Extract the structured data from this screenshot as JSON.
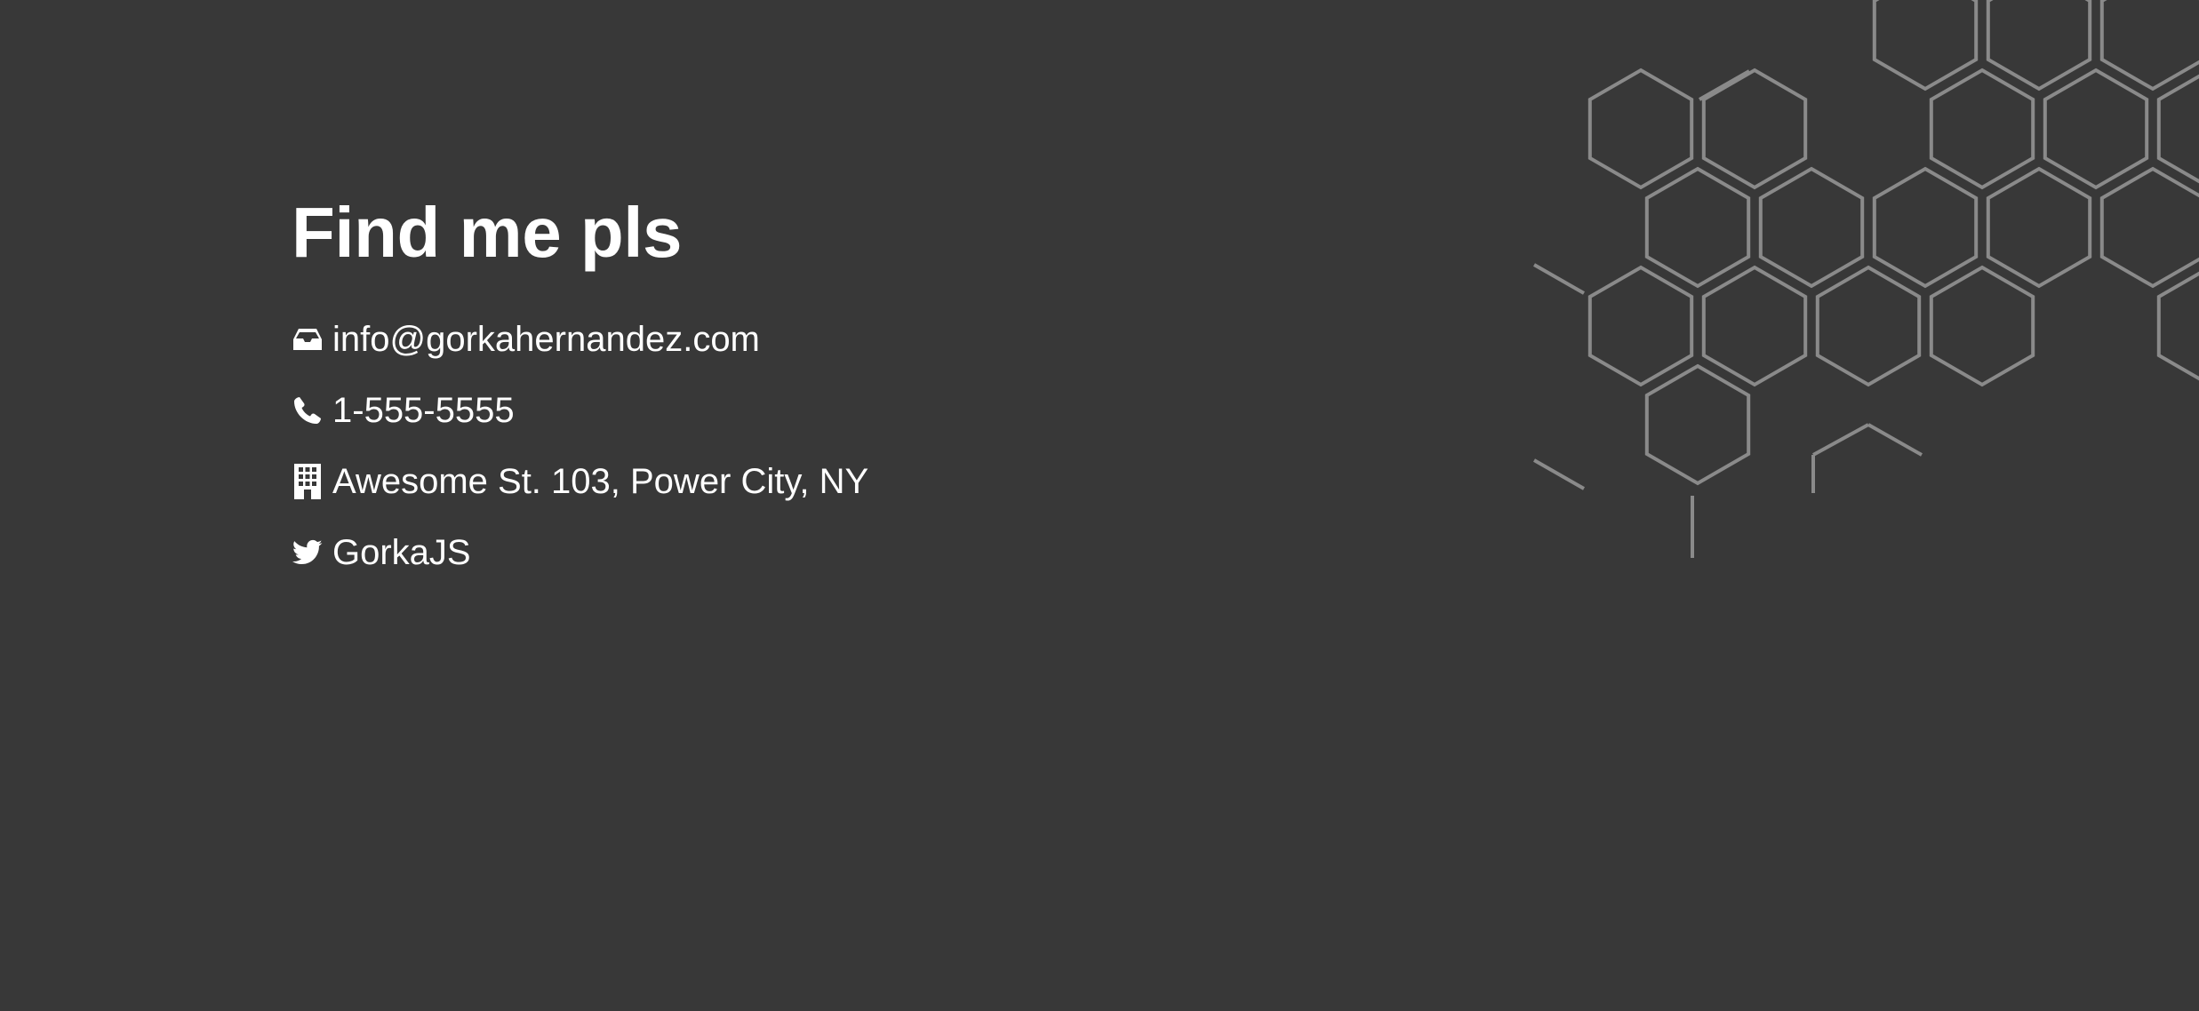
{
  "contact": {
    "title": "Find me pls",
    "items": [
      {
        "icon": "inbox-icon",
        "text": "info@gorkahernandez.com"
      },
      {
        "icon": "phone-icon",
        "text": "1-555-5555"
      },
      {
        "icon": "building-icon",
        "text": "Awesome St. 103, Power City, NY"
      },
      {
        "icon": "twitter-icon",
        "text": "GorkaJS"
      }
    ]
  },
  "colors": {
    "background": "#383838",
    "text": "#ffffff",
    "hex_lines": "#8a8a8a"
  }
}
